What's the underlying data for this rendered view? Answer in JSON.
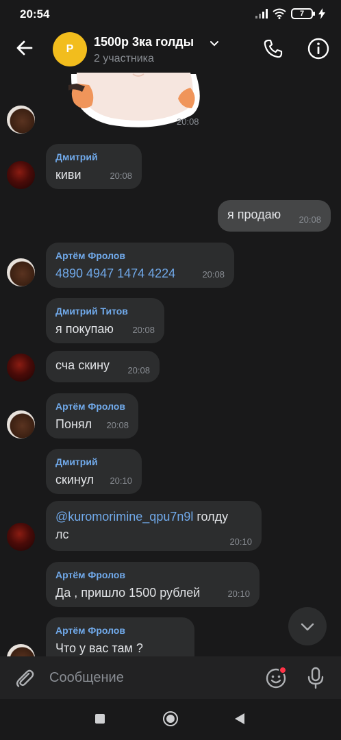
{
  "status_bar": {
    "time": "20:54",
    "battery": "7"
  },
  "header": {
    "avatar_letter": "P",
    "title": "1500р 3ка голды",
    "subtitle": "2 участника",
    "accent_color": "#f2bd1d"
  },
  "messages": [
    {
      "id": "m0",
      "type": "sticker",
      "time": "20:08"
    },
    {
      "id": "m1",
      "sender": "Дмитрий",
      "text": "киви",
      "time": "20:08"
    },
    {
      "id": "m2",
      "outgoing": true,
      "text": "я продаю",
      "time": "20:08"
    },
    {
      "id": "m3",
      "sender": "Артём Фролов",
      "text": "4890 4947 1474 4224",
      "time": "20:08"
    },
    {
      "id": "m4",
      "sender": "Дмитрий Титов",
      "text": "я покупаю",
      "time": "20:08"
    },
    {
      "id": "m5",
      "text": "сча скину",
      "time": "20:08"
    },
    {
      "id": "m6",
      "sender": "Артём Фролов",
      "text": "Понял",
      "time": "20:08"
    },
    {
      "id": "m7",
      "sender": "Дмитрий",
      "text": "скинул",
      "time": "20:10"
    },
    {
      "id": "m8",
      "mention": "@kuromorimine_qpu7n9l",
      "text_after": " голду",
      "text_line2": "лс",
      "time": "20:10"
    },
    {
      "id": "m9",
      "sender": "Артём Фролов",
      "text": "Да , пришло 1500 рублей",
      "time": "20:10"
    },
    {
      "id": "m10",
      "sender": "Артём Фролов",
      "text": "Что у вас там ?"
    }
  ],
  "composer": {
    "placeholder": "Сообщение"
  },
  "icons": {
    "back": "arrow-left-icon",
    "call": "phone-icon",
    "info": "info-icon",
    "attach": "paperclip-icon",
    "emoji": "emoji-icon",
    "mic": "microphone-icon",
    "scroll": "chevron-down-icon"
  },
  "colors": {
    "background": "#19191a",
    "bubble_in": "#2c2d2e",
    "bubble_out": "#454647",
    "link": "#71aaeb",
    "notification_dot": "#ff3347"
  }
}
